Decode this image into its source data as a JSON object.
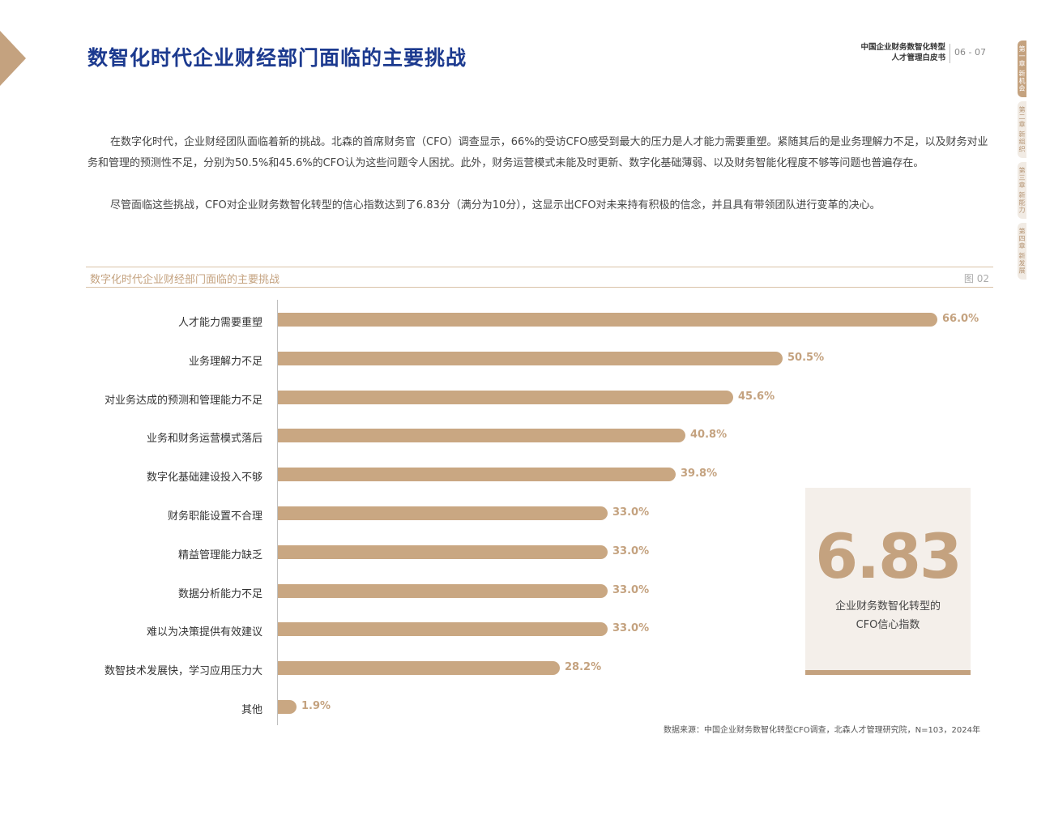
{
  "header": {
    "title": "数智化时代企业财经部门面临的主要挑战",
    "report_line1": "中国企业财务数智化转型",
    "report_line2": "人才管理白皮书",
    "page_numbers": "06 - 07"
  },
  "side_tabs": [
    {
      "label": "第一章 新机会",
      "active": true
    },
    {
      "label": "第二章 新组织",
      "active": false
    },
    {
      "label": "第三章 新能力",
      "active": false
    },
    {
      "label": "第四章 新发展",
      "active": false
    }
  ],
  "body": {
    "paragraph1": "在数字化时代，企业财经团队面临着新的挑战。北森的首席财务官（CFO）调查显示，66%的受访CFO感受到最大的压力是人才能力需要重塑。紧随其后的是业务理解力不足，以及财务对业务和管理的预测性不足，分别为50.5%和45.6%的CFO认为这些问题令人困扰。此外，财务运营模式未能及时更新、数字化基础薄弱、以及财务智能化程度不够等问题也普遍存在。",
    "paragraph2": "尽管面临这些挑战，CFO对企业财务数智化转型的信心指数达到了6.83分（满分为10分），这显示出CFO对未来持有积极的信念，并且具有带领团队进行变革的决心。"
  },
  "figure": {
    "title": "数字化时代企业财经部门面临的主要挑战",
    "number": "图 02",
    "source": "数据来源：中国企业财务数智化转型CFO调查，北森人才管理研究院，N=103，2024年"
  },
  "index_card": {
    "value": "6.83",
    "label_line1": "企业财务数智化转型的",
    "label_line2": "CFO信心指数"
  },
  "chart_data": {
    "type": "bar",
    "orientation": "horizontal",
    "title": "数字化时代企业财经部门面临的主要挑战",
    "categories": [
      "人才能力需要重塑",
      "业务理解力不足",
      "对业务达成的预测和管理能力不足",
      "业务和财务运营模式落后",
      "数字化基础建设投入不够",
      "财务职能设置不合理",
      "精益管理能力缺乏",
      "数据分析能力不足",
      "难以为决策提供有效建议",
      "数智技术发展快，学习应用压力大",
      "其他"
    ],
    "values": [
      66.0,
      50.5,
      45.6,
      40.8,
      39.8,
      33.0,
      33.0,
      33.0,
      33.0,
      28.2,
      1.9
    ],
    "value_labels": [
      "66.0%",
      "50.5%",
      "45.6%",
      "40.8%",
      "39.8%",
      "33.0%",
      "33.0%",
      "33.0%",
      "33.0%",
      "28.2%",
      "1.9%"
    ],
    "xlim": [
      0,
      66
    ],
    "bar_color": "#c9a782",
    "label_color": "#c4a27f"
  }
}
